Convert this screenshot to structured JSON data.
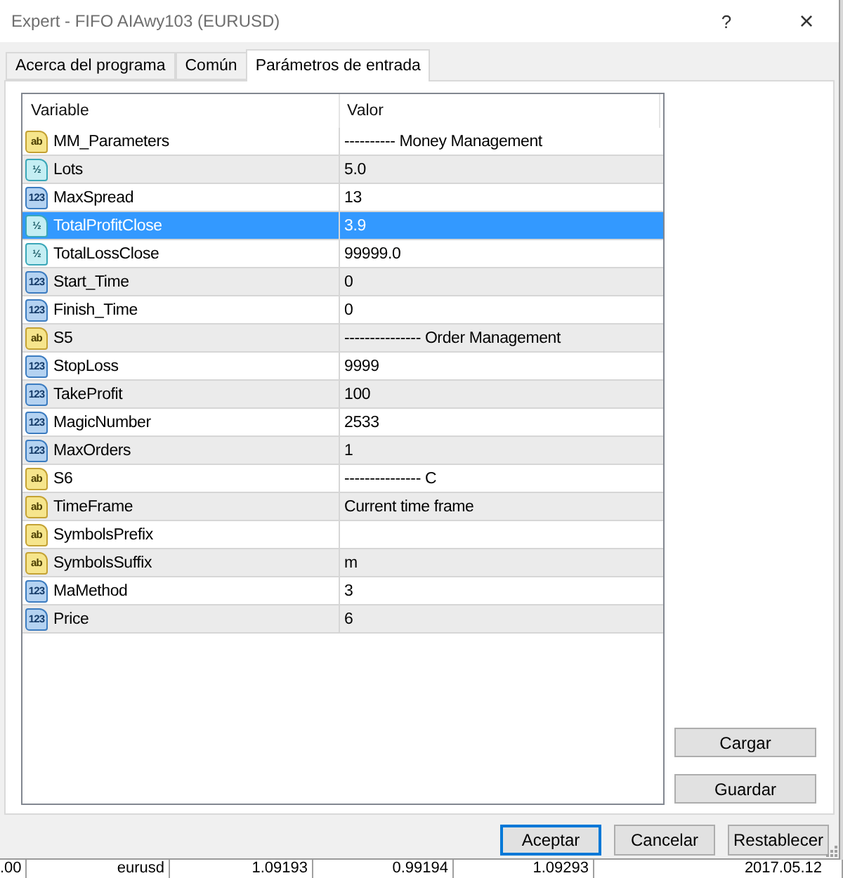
{
  "window": {
    "title": "Expert - FIFO AIAwy103 (EURUSD)",
    "title_buttons": [
      "?",
      "×"
    ]
  },
  "tabs": [
    {
      "label": "Acerca del programa",
      "selected": false
    },
    {
      "label": "Común",
      "selected": false
    },
    {
      "label": "Parámetros de entrada",
      "selected": true
    }
  ],
  "table": {
    "columns": [
      "Variable",
      "Valor"
    ],
    "rows": [
      {
        "kind": "string",
        "type_label": "ab",
        "variable": "MM_Parameters",
        "value": "---------- Money Management",
        "selected": false
      },
      {
        "kind": "double",
        "type_label": "½",
        "variable": "Lots",
        "value": "5.0",
        "selected": false
      },
      {
        "kind": "integer",
        "type_label": "123",
        "variable": "MaxSpread",
        "value": "13",
        "selected": false
      },
      {
        "kind": "double",
        "type_label": "½",
        "variable": "TotalProfitClose",
        "value": "3.9",
        "selected": true
      },
      {
        "kind": "double",
        "type_label": "½",
        "variable": "TotalLossClose",
        "value": "99999.0",
        "selected": false
      },
      {
        "kind": "integer",
        "type_label": "123",
        "variable": "Start_Time",
        "value": "0",
        "selected": false
      },
      {
        "kind": "integer",
        "type_label": "123",
        "variable": "Finish_Time",
        "value": "0",
        "selected": false
      },
      {
        "kind": "string",
        "type_label": "ab",
        "variable": "S5",
        "value": "--------------- Order Management",
        "selected": false
      },
      {
        "kind": "integer",
        "type_label": "123",
        "variable": "StopLoss",
        "value": "9999",
        "selected": false
      },
      {
        "kind": "integer",
        "type_label": "123",
        "variable": "TakeProfit",
        "value": "100",
        "selected": false
      },
      {
        "kind": "integer",
        "type_label": "123",
        "variable": "MagicNumber",
        "value": "2533",
        "selected": false
      },
      {
        "kind": "integer",
        "type_label": "123",
        "variable": "MaxOrders",
        "value": "1",
        "selected": false
      },
      {
        "kind": "string",
        "type_label": "ab",
        "variable": "S6",
        "value": "--------------- C",
        "selected": false
      },
      {
        "kind": "string",
        "type_label": "ab",
        "variable": "TimeFrame",
        "value": "Current time frame",
        "selected": false
      },
      {
        "kind": "string",
        "type_label": "ab",
        "variable": "SymbolsPrefix",
        "selected": false
      },
      {
        "kind": "string",
        "type_label": "ab",
        "variable": "SymbolsSuffix",
        "value": "m",
        "selected": false
      },
      {
        "kind": "integer",
        "type_label": "123",
        "variable": "MaMethod",
        "value": "3",
        "selected": false
      },
      {
        "kind": "integer",
        "type_label": "123",
        "variable": "Price",
        "value": "6",
        "selected": false
      }
    ]
  },
  "side_buttons": [
    "Cargar",
    "Guardar"
  ],
  "dialog_buttons": [
    {
      "label": "Aceptar",
      "default": true
    },
    {
      "label": "Cancelar",
      "default": false
    },
    {
      "label": "Restablecer",
      "default": false
    }
  ],
  "background_table_row": {
    "cells": [
      ".00",
      "eurusd",
      "1.09193",
      "0.99194",
      "1.09293",
      "2017.05.12"
    ]
  }
}
